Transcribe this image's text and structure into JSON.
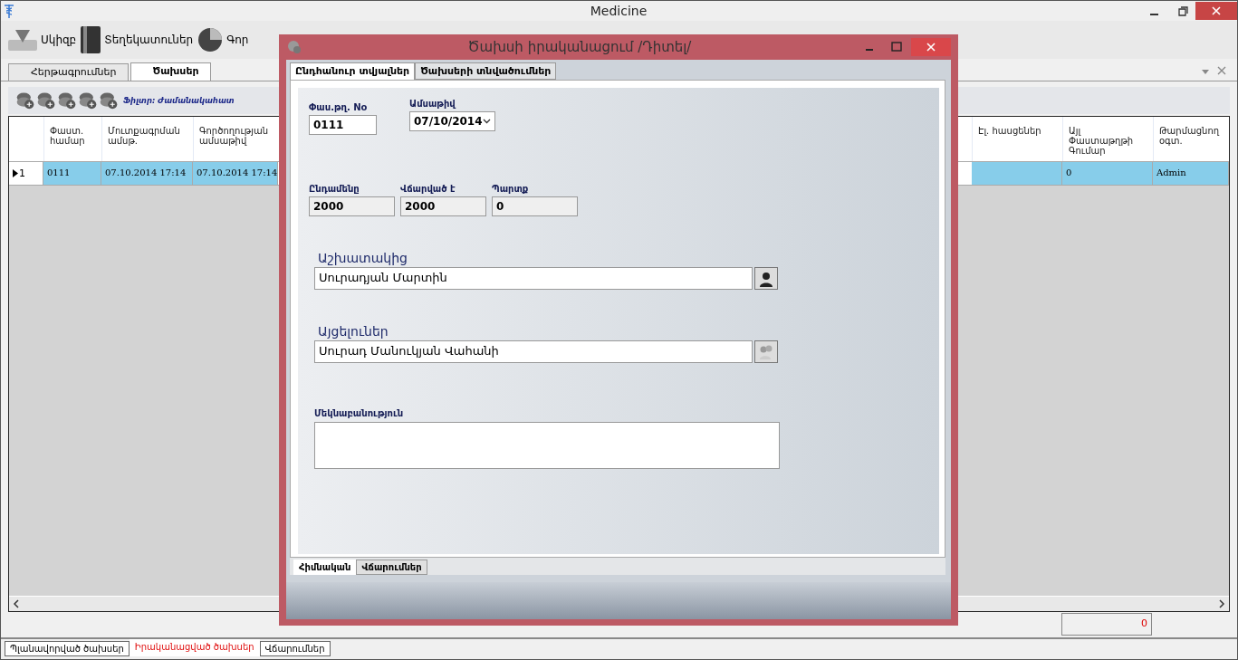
{
  "window": {
    "title": "Medicine"
  },
  "toolbar": [
    {
      "label": "Սկիզբ",
      "kind": "start"
    },
    {
      "label": "Տեղեկատուներ",
      "kind": "book"
    },
    {
      "label": "Գոր",
      "kind": "chart"
    }
  ],
  "tabs": [
    {
      "label": "Հերթագրումներ",
      "selected": false
    },
    {
      "label": "Ծախսեր",
      "selected": true
    }
  ],
  "filter": {
    "text": "Ֆիլտր: Ժամանակահատ"
  },
  "table": {
    "columns": [
      "Փաստ. համար",
      "Մուտքագրման ամսթ.",
      "Գործողության ամսաթիվ",
      "Էլ. հասցեներ",
      "Այլ Փաստաթղթի Գումար",
      "Թարմացնող օգտ."
    ],
    "rows": [
      {
        "marker": "1",
        "selected": true,
        "cells": [
          "0111",
          "07.10.2014 17:14",
          "07.10.2014 17:14",
          null,
          "0",
          "Admin"
        ]
      }
    ],
    "other_amount_total": "0"
  },
  "bottom_tabs": [
    {
      "label": "Պլանավորված ծախսեր",
      "selected": false
    },
    {
      "label": "Իրականացված ծախսեր",
      "selected": true
    },
    {
      "label": "Վճարումներ",
      "selected": false
    }
  ],
  "dialog": {
    "title": "Ծախսի իրականացում  /Դիտել/",
    "tabs": [
      {
        "label": "Ընդհանուր տվյալներ",
        "selected": true
      },
      {
        "label": "Ծախսերի տնվածումներ",
        "selected": false
      }
    ],
    "doc_number": {
      "label": "Փաս.թղ. No",
      "value": "0111"
    },
    "date": {
      "label": "Ամսաթիվ",
      "value": "07/10/2014"
    },
    "amounts": [
      {
        "label": "Ընդամենը",
        "value": "2000"
      },
      {
        "label": "Վճարված է",
        "value": "2000"
      },
      {
        "label": "Պարտք",
        "value": "0"
      }
    ],
    "employee": {
      "label": "Աշխատակից",
      "value": "Սուրադյան Մարտին"
    },
    "visitors": {
      "label": "Այցելուներ",
      "value": "Սուրադ Մանուկյան Վահանի"
    },
    "description": {
      "label": "Մեկնաբանություն"
    },
    "bottom_tabs": [
      {
        "label": "Հիմնական",
        "selected": true
      },
      {
        "label": "Վճարումներ",
        "selected": false
      }
    ]
  }
}
